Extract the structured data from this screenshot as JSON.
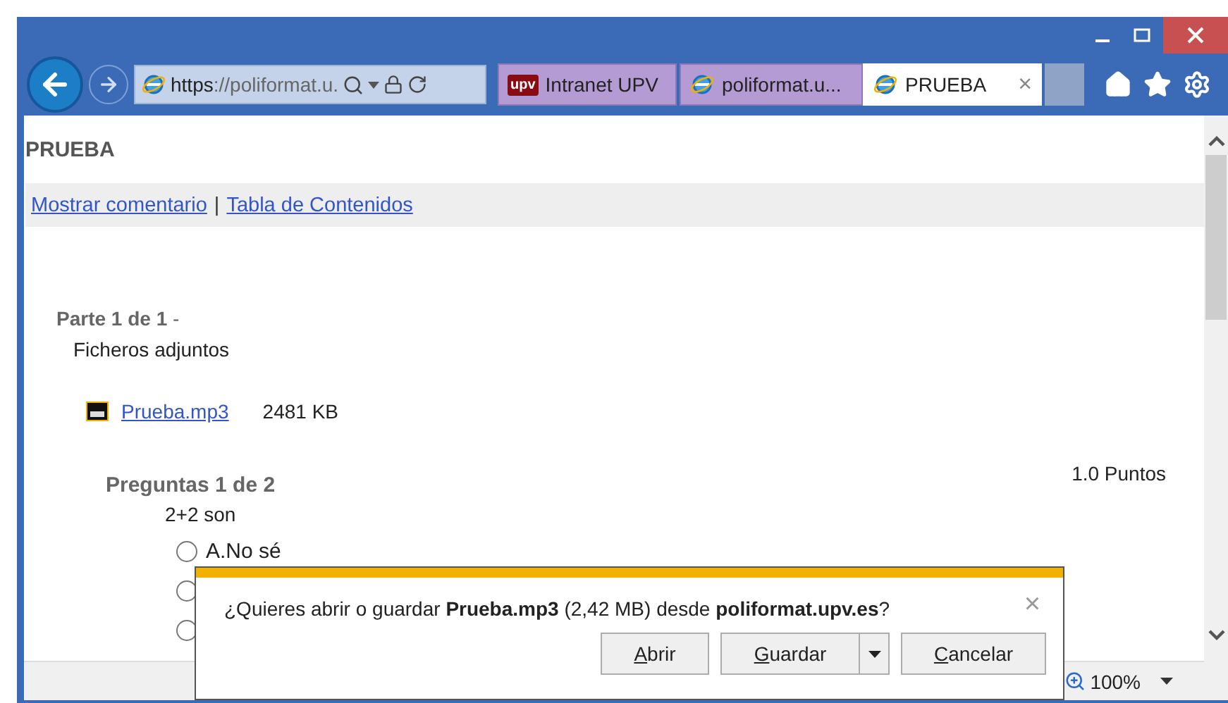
{
  "address_bar": {
    "url_strong": "https",
    "url_rest": "://poliformat.u."
  },
  "tabs": [
    {
      "kind": "upv",
      "logo_text": "upv",
      "label": "Intranet UPV",
      "selected": false
    },
    {
      "kind": "ie",
      "label": "poliformat.u...",
      "selected": false
    },
    {
      "kind": "ie",
      "label": "PRUEBA",
      "close": "×",
      "selected": true
    }
  ],
  "page": {
    "title": "PRUEBA",
    "links": [
      "Mostrar comentario",
      "Tabla de Contenidos"
    ],
    "separator": "|",
    "part": "Parte 1 de 1",
    "part_suffix": "-",
    "attachments_label": "Ficheros adjuntos",
    "attachment": {
      "name": "Prueba.mp3",
      "size": "2481 KB"
    },
    "points": "1.0 Puntos",
    "question_header": "Preguntas 1 de 2",
    "question": "2+2 son",
    "answers": [
      {
        "label": "A.No sé",
        "selected": false
      },
      {
        "selected": false
      },
      {
        "selected": false
      }
    ]
  },
  "status_bar": {
    "zoom": "100%"
  },
  "dialog": {
    "message": "¿Quieres abrir o guardar **Prueba.mp3** (2,42 MB) desde **poliformat.upv.es**?",
    "close": "×",
    "buttons": [
      {
        "kind": "plain",
        "key": "A",
        "rest": "brir"
      },
      {
        "kind": "split",
        "key": "G",
        "rest": "uardar"
      },
      {
        "kind": "plain",
        "key": "C",
        "rest": "ancelar"
      }
    ]
  }
}
